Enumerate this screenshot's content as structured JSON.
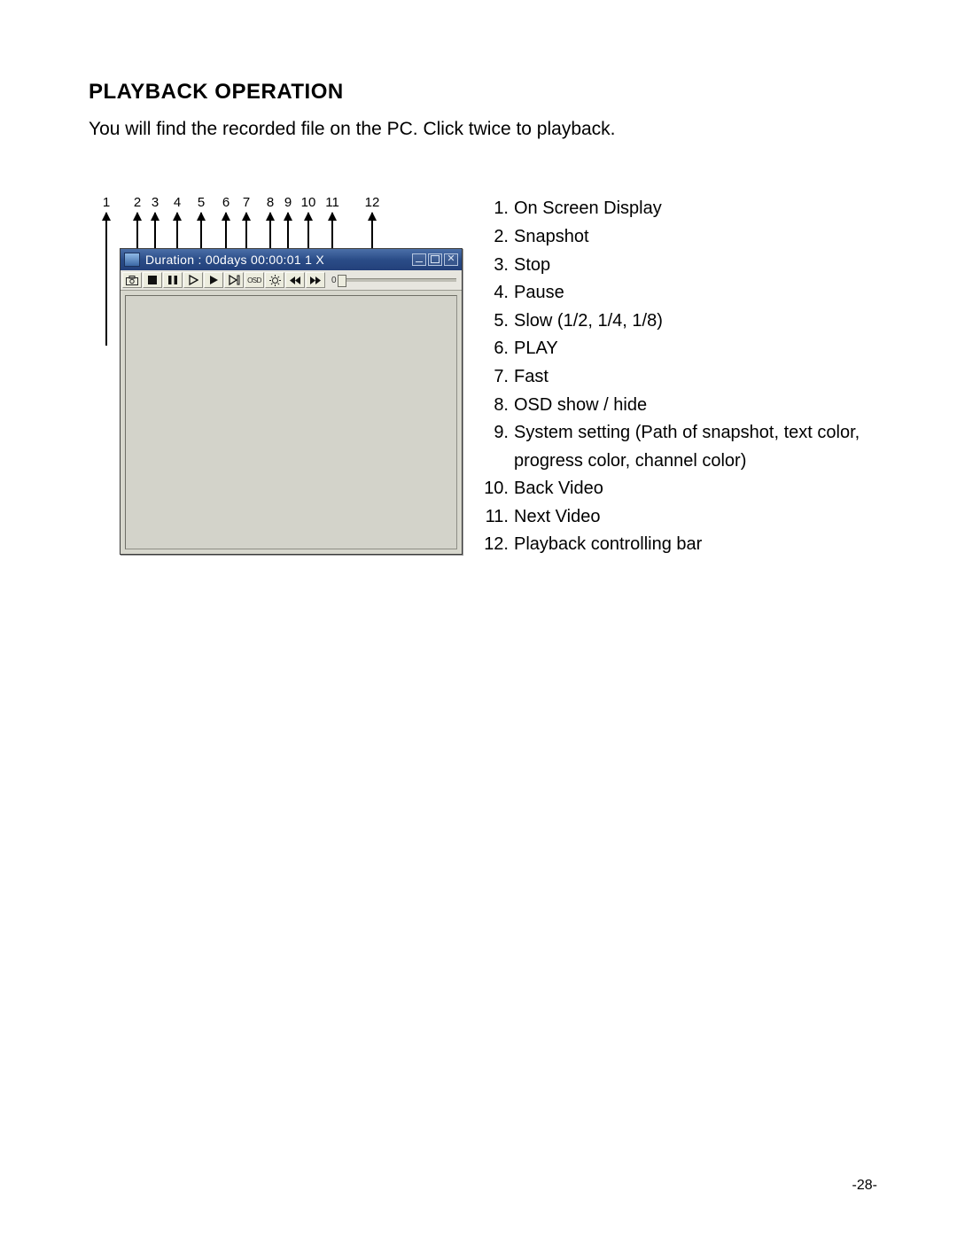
{
  "section_title": "PLAYBACK OPERATION",
  "intro_text": "You will find the recorded file on the PC. Click twice to playback.",
  "page_number": "-28-",
  "callout_labels": [
    "1",
    "2",
    "3",
    "4",
    "5",
    "6",
    "7",
    "8",
    "9",
    "10",
    "11",
    "12"
  ],
  "titlebar": {
    "duration": "Duration : 00days 00:00:01  1 X"
  },
  "toolbar": {
    "osd_button_text": "OSD",
    "slider_label": "0"
  },
  "legend": [
    {
      "n": "1.",
      "text": "On Screen Display"
    },
    {
      "n": "2.",
      "text": "Snapshot"
    },
    {
      "n": "3.",
      "text": "Stop"
    },
    {
      "n": "4.",
      "text": "Pause"
    },
    {
      "n": "5.",
      "text": "Slow (1/2, 1/4, 1/8)"
    },
    {
      "n": "6.",
      "text": "PLAY"
    },
    {
      "n": "7.",
      "text": "Fast"
    },
    {
      "n": "8.",
      "text": "OSD show / hide"
    },
    {
      "n": "9.",
      "text": "System setting (Path of snapshot, text color, progress color, channel color)"
    },
    {
      "n": "10.",
      "text": "Back Video"
    },
    {
      "n": "11.",
      "text": "Next Video"
    },
    {
      "n": "12.",
      "text": "Playback controlling bar"
    }
  ]
}
